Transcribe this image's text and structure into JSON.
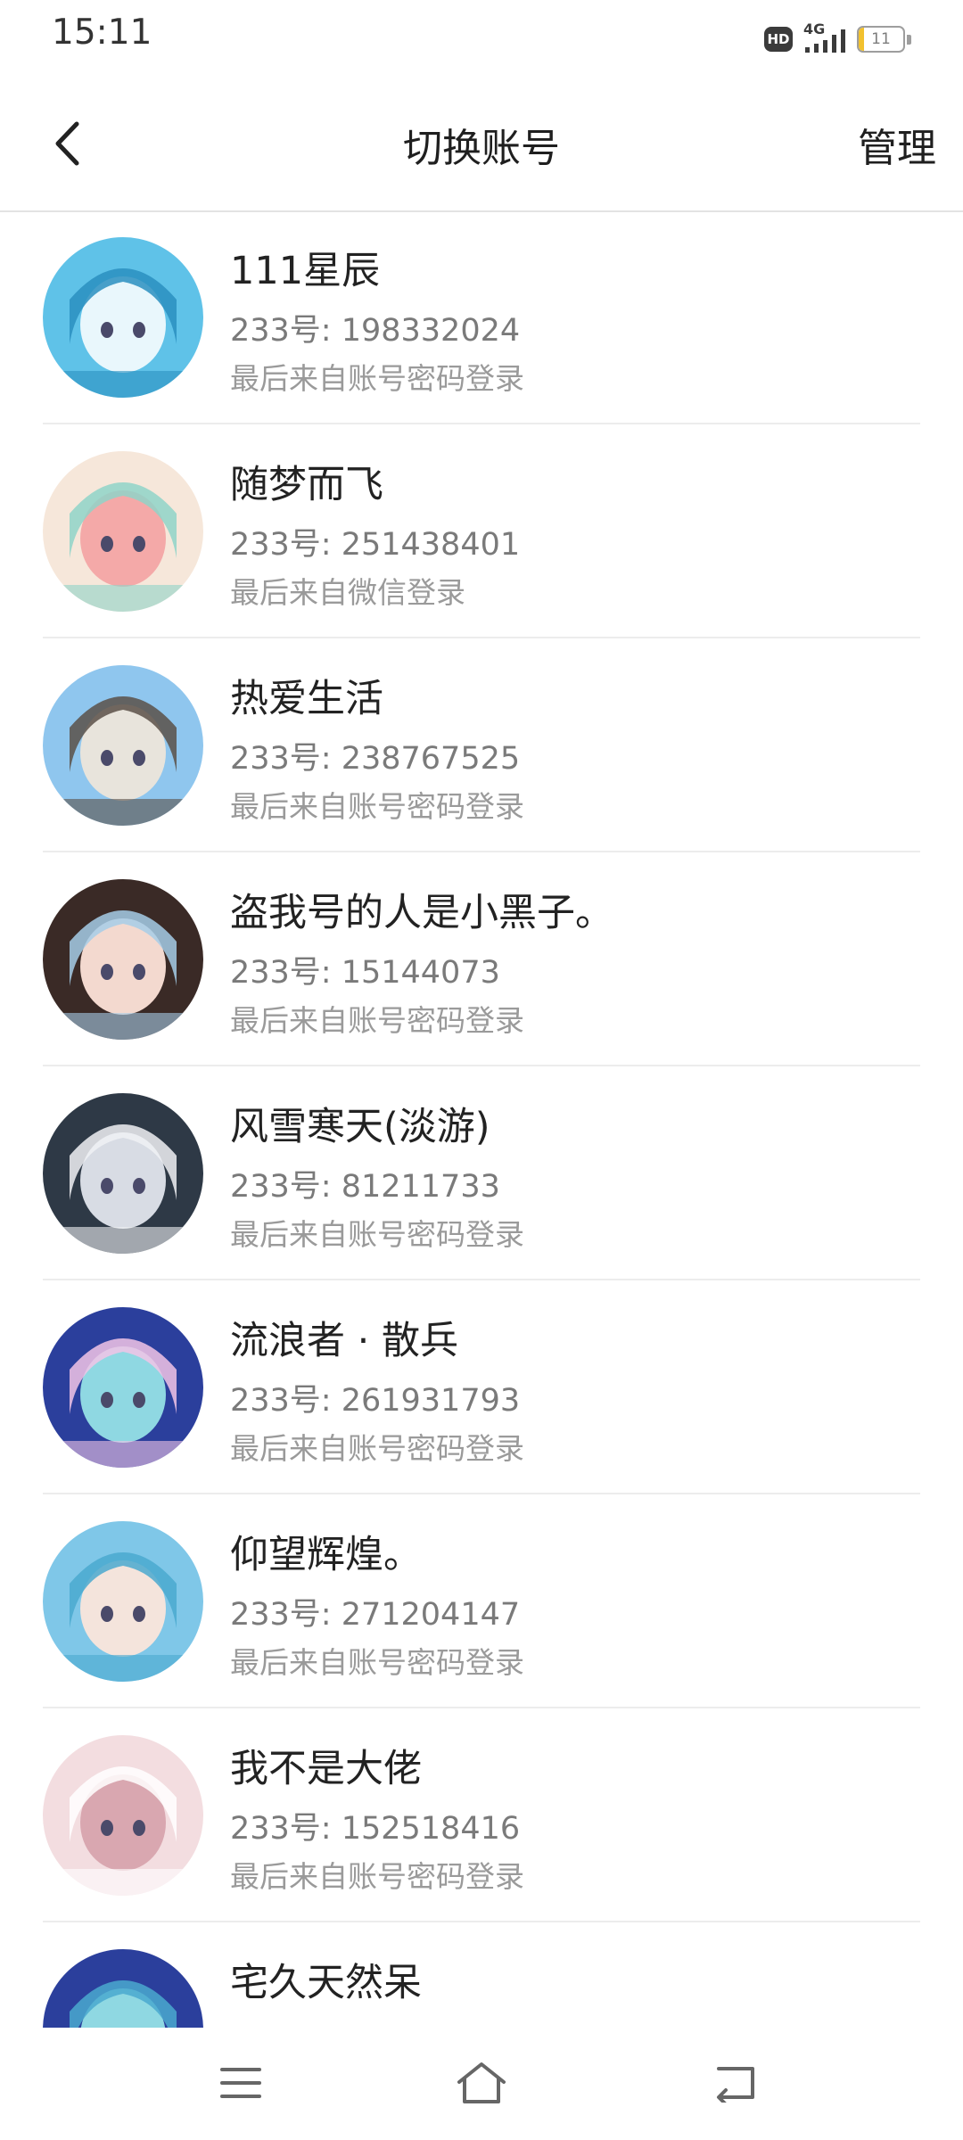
{
  "status_bar": {
    "time": "15:11",
    "hd_label": "HD",
    "network_label": "4G",
    "battery_level": "11",
    "battery_fraction": 0.11,
    "battery_fill_color": "#f2c12e"
  },
  "header": {
    "title": "切换账号",
    "manage_label": "管理",
    "back_icon": "chevron-left-icon"
  },
  "accounts": [
    {
      "name": "111星辰",
      "id_text": "233号: 198332024",
      "source": "最后来自账号密码登录",
      "avatar_colors": [
        "#5fc2e8",
        "#e9f7fc",
        "#2a8fc0"
      ]
    },
    {
      "name": "随梦而飞",
      "id_text": "233号: 251438401",
      "source": "最后来自微信登录",
      "avatar_colors": [
        "#f6e7da",
        "#f4a9a8",
        "#8fd3c8"
      ]
    },
    {
      "name": "热爱生活",
      "id_text": "233号: 238767525",
      "source": "最后来自账号密码登录",
      "avatar_colors": [
        "#8fc6ee",
        "#e8e4dc",
        "#5a5048"
      ]
    },
    {
      "name": "盗我号的人是小黑子。",
      "id_text": "233号: 15144073",
      "source": "最后来自账号密码登录",
      "avatar_colors": [
        "#3a2a26",
        "#f3d9cf",
        "#a6cde8"
      ]
    },
    {
      "name": "风雪寒天(淡游)",
      "id_text": "233号: 81211733",
      "source": "最后来自账号密码登录",
      "avatar_colors": [
        "#2e3946",
        "#d8dce4",
        "#f0f1f4"
      ]
    },
    {
      "name": "流浪者 · 散兵",
      "id_text": "233号: 261931793",
      "source": "最后来自账号密码登录",
      "avatar_colors": [
        "#2b3f9c",
        "#8fd8e2",
        "#f2c4e6"
      ]
    },
    {
      "name": "仰望辉煌。",
      "id_text": "233号: 271204147",
      "source": "最后来自账号密码登录",
      "avatar_colors": [
        "#7fc7e8",
        "#f4e4dc",
        "#4aa9cf"
      ]
    },
    {
      "name": "我不是大佬",
      "id_text": "233号: 152518416",
      "source": "最后来自账号密码登录",
      "avatar_colors": [
        "#f3dde0",
        "#d9a7b0",
        "#ffffff"
      ]
    },
    {
      "name": "宅久天然呆",
      "id_text": "",
      "source": "",
      "avatar_colors": [
        "#2b3f9c",
        "#8fd8e2",
        "#4aa9cf"
      ]
    }
  ],
  "nav_bar": {
    "menu_icon": "menu-icon",
    "home_icon": "home-icon",
    "back_icon": "back-arrow-icon"
  }
}
